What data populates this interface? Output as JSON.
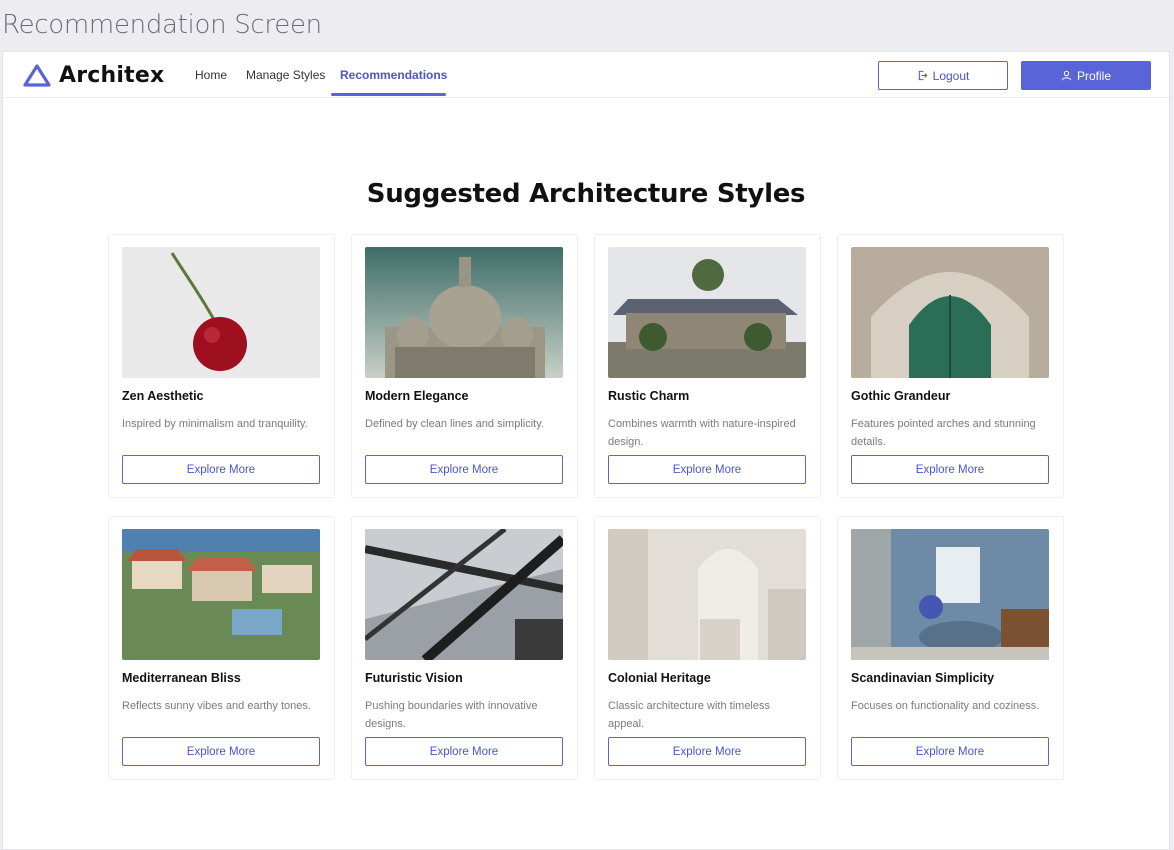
{
  "screen_label": "Recommendation Screen",
  "brand": {
    "name": "Architex",
    "logo_icon": "triangle-logo-icon",
    "accent": "#5a64d9"
  },
  "nav": [
    {
      "label": "Home",
      "active": false
    },
    {
      "label": "Manage Styles",
      "active": false
    },
    {
      "label": "Recommendations",
      "active": true
    }
  ],
  "actions": {
    "logout_label": "Logout",
    "logout_icon": "logout-icon",
    "profile_label": "Profile",
    "profile_icon": "user-icon"
  },
  "heading": "Suggested Architecture Styles",
  "cards": [
    {
      "title": "Zen Aesthetic",
      "description": "Inspired by minimalism and tranquility.",
      "button": "Explore More"
    },
    {
      "title": "Modern Elegance",
      "description": "Defined by clean lines and simplicity.",
      "button": "Explore More"
    },
    {
      "title": "Rustic Charm",
      "description": "Combines warmth with nature-inspired design.",
      "button": "Explore More"
    },
    {
      "title": "Gothic Grandeur",
      "description": "Features pointed arches and stunning details.",
      "button": "Explore More"
    },
    {
      "title": "Mediterranean Bliss",
      "description": "Reflects sunny vibes and earthy tones.",
      "button": "Explore More"
    },
    {
      "title": "Futuristic Vision",
      "description": "Pushing boundaries with innovative designs.",
      "button": "Explore More"
    },
    {
      "title": "Colonial Heritage",
      "description": "Classic architecture with timeless appeal.",
      "button": "Explore More"
    },
    {
      "title": "Scandinavian Simplicity",
      "description": "Focuses on functionality and coziness.",
      "button": "Explore More"
    }
  ]
}
